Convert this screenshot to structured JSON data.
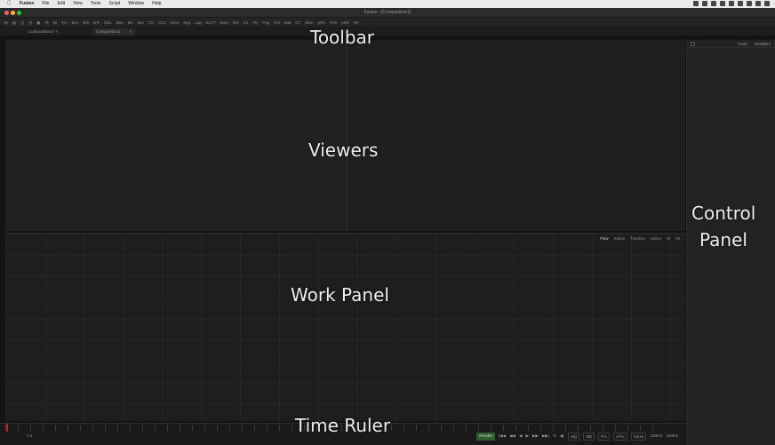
{
  "menubar": {
    "apple": "",
    "menus": [
      "Fusion",
      "File",
      "Edit",
      "View",
      "Tools",
      "Script",
      "Window",
      "Help"
    ]
  },
  "window": {
    "title": "Fusion - [Composition1]"
  },
  "toolbar": {
    "tools": [
      "⊞",
      "▤",
      "◫",
      "⊟",
      "▣",
      "Ⓦ",
      "Bl",
      "Trn",
      "BCr",
      "Brk",
      "BTr",
      "DSL",
      "Blur",
      "BC",
      "Bol",
      "CC",
      "CCv",
      "MCe",
      "Mrg",
      "Lag",
      "KLYT",
      "Bmp",
      "Glo",
      "Cx",
      "Fly",
      "Png",
      "Kst",
      "Mat",
      "CT",
      "pEm",
      "pRn",
      "Prm",
      "pRd",
      "SP"
    ]
  },
  "composition_tabs": [
    "Composition1*",
    "Composition1"
  ],
  "work_panel": {
    "tabs": [
      "Flow",
      "Spline",
      "Timeline",
      "Splice",
      "Bi",
      "Mi"
    ]
  },
  "control_panel": {
    "tabs": [
      "Tools",
      "Modifiers"
    ]
  },
  "transport": {
    "render_label": "Render",
    "controls": [
      "|◀◀",
      "◀◀",
      "◀",
      "▶",
      "▶▶",
      "▶▶|",
      "⟲",
      "◀)"
    ],
    "buttons": [
      "HiQ",
      "MB",
      "Prx",
      "APrx",
      "Some"
    ],
    "current_frame": "1000.0",
    "end_frame": "1000.0",
    "start_frame": "0.0"
  },
  "overlay_labels": {
    "toolbar": "Toolbar",
    "viewers": "Viewers",
    "work_panel": "Work Panel",
    "time_ruler": "Time Ruler",
    "control_panel_line1": "Control",
    "control_panel_line2": "Panel"
  },
  "colors": {
    "render_button": "#2f5d2f",
    "playhead": "#bb2222",
    "traffic_red": "#ff5f57",
    "traffic_yellow": "#febc2e",
    "traffic_green": "#28c840"
  }
}
